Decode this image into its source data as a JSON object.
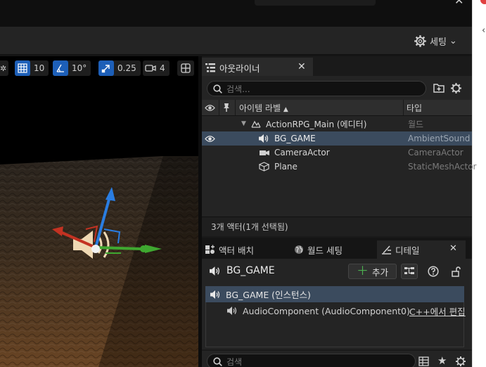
{
  "viewport": {
    "grid_snap": "10",
    "rotation_snap": "10°",
    "scale_snap": "0.25",
    "camera_speed": "4"
  },
  "toolbar": {
    "settings_label": "세팅"
  },
  "outliner": {
    "tab_title": "아웃라이너",
    "search_placeholder": "검색...",
    "col_label": "아이템 라벨",
    "col_type": "타입",
    "rows": [
      {
        "name": "ActionRPG_Main (에디터)",
        "type": "월드"
      },
      {
        "name": "BG_GAME",
        "type": "AmbientSound"
      },
      {
        "name": "CameraActor",
        "type": "CameraActor"
      },
      {
        "name": "Plane",
        "type": "StaticMeshActor"
      }
    ],
    "footer": "3개 액터(1개 선택됨)"
  },
  "details": {
    "tab_place_actors": "액터 배치",
    "tab_world_settings": "월드 세팅",
    "tab_details": "디테일",
    "actor_name": "BG_GAME",
    "add_label": "추가",
    "root_component": "BG_GAME (인스턴스)",
    "child_component": "AudioComponent (AudioComponent0)",
    "edit_in_cpp": "C++에서 편집",
    "search_placeholder": "검색"
  },
  "colors": {
    "selection": "#3b4b5e",
    "accent_blue": "#1d5fb8",
    "add_green": "#4caf50"
  }
}
